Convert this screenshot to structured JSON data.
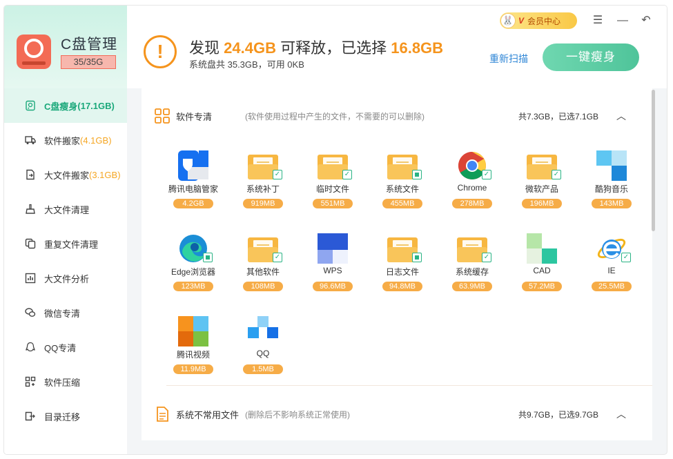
{
  "sidebar": {
    "title": "C盘管理",
    "usage": "35/35G",
    "items": [
      {
        "label": "C盘瘦身",
        "extra": "(17.1GB)",
        "icon": "clean-icon",
        "active": true
      },
      {
        "label": "软件搬家",
        "extra": "(4.1GB)",
        "icon": "truck-icon"
      },
      {
        "label": "大文件搬家",
        "extra": "(3.1GB)",
        "icon": "file-move-icon"
      },
      {
        "label": "大文件清理",
        "extra": "",
        "icon": "broom-icon"
      },
      {
        "label": "重复文件清理",
        "extra": "",
        "icon": "duplicate-icon"
      },
      {
        "label": "大文件分析",
        "extra": "",
        "icon": "chart-icon"
      },
      {
        "label": "微信专清",
        "extra": "",
        "icon": "wechat-icon"
      },
      {
        "label": "QQ专清",
        "extra": "",
        "icon": "qq-icon"
      },
      {
        "label": "软件压缩",
        "extra": "",
        "icon": "compress-icon"
      },
      {
        "label": "目录迁移",
        "extra": "",
        "icon": "folder-move-icon"
      }
    ]
  },
  "header": {
    "headline_prefix": "发现",
    "found_size": "24.4GB",
    "headline_mid": "可释放，已选择",
    "selected_size": "16.8GB",
    "subline": "系统盘共 35.3GB，可用 0KB",
    "rescan": "重新扫描",
    "primary_button": "一键瘦身",
    "vip_label": "会员中心",
    "vip_letter": "V"
  },
  "sections": [
    {
      "title": "软件专清",
      "desc": "(软件使用过程中产生的文件，不需要的可以删除)",
      "total": "共7.3GB，已选7.1GB"
    },
    {
      "title": "系统不常用文件",
      "desc": "(删除后不影响系统正常使用)",
      "total": "共9.7GB，已选9.7GB"
    }
  ],
  "tiles": [
    {
      "name": "腾讯电脑管家",
      "size": "4.2GB",
      "icon": "tencent-pcmanager-icon",
      "check": "none"
    },
    {
      "name": "系统补丁",
      "size": "919MB",
      "icon": "folder-icon",
      "check": "checked"
    },
    {
      "name": "临时文件",
      "size": "551MB",
      "icon": "folder-icon",
      "check": "checked"
    },
    {
      "name": "系统文件",
      "size": "455MB",
      "icon": "folder-icon",
      "check": "partial"
    },
    {
      "name": "Chrome",
      "size": "278MB",
      "icon": "chrome-icon",
      "check": "checked"
    },
    {
      "name": "微软产品",
      "size": "196MB",
      "icon": "folder-icon",
      "check": "checked"
    },
    {
      "name": "酷狗音乐",
      "size": "143MB",
      "icon": "kugou-icon",
      "check": "none"
    },
    {
      "name": "Edge浏览器",
      "size": "123MB",
      "icon": "edge-icon",
      "check": "partial"
    },
    {
      "name": "其他软件",
      "size": "108MB",
      "icon": "folder-icon",
      "check": "checked"
    },
    {
      "name": "WPS",
      "size": "96.6MB",
      "icon": "wps-icon",
      "check": "none"
    },
    {
      "name": "日志文件",
      "size": "94.8MB",
      "icon": "folder-icon",
      "check": "partial"
    },
    {
      "name": "系统缓存",
      "size": "63.9MB",
      "icon": "folder-icon",
      "check": "checked"
    },
    {
      "name": "CAD",
      "size": "57.2MB",
      "icon": "cad-icon",
      "check": "none"
    },
    {
      "name": "IE",
      "size": "25.5MB",
      "icon": "ie-icon",
      "check": "checked"
    },
    {
      "name": "腾讯视频",
      "size": "11.9MB",
      "icon": "tencent-video-icon",
      "check": "none"
    },
    {
      "name": "QQ",
      "size": "1.5MB",
      "icon": "qq-app-icon",
      "check": "none"
    }
  ],
  "colors": {
    "accent_green": "#1aa87a",
    "accent_orange": "#f5941d",
    "size_pill": "#f6ac47",
    "check_green": "#29b384"
  }
}
